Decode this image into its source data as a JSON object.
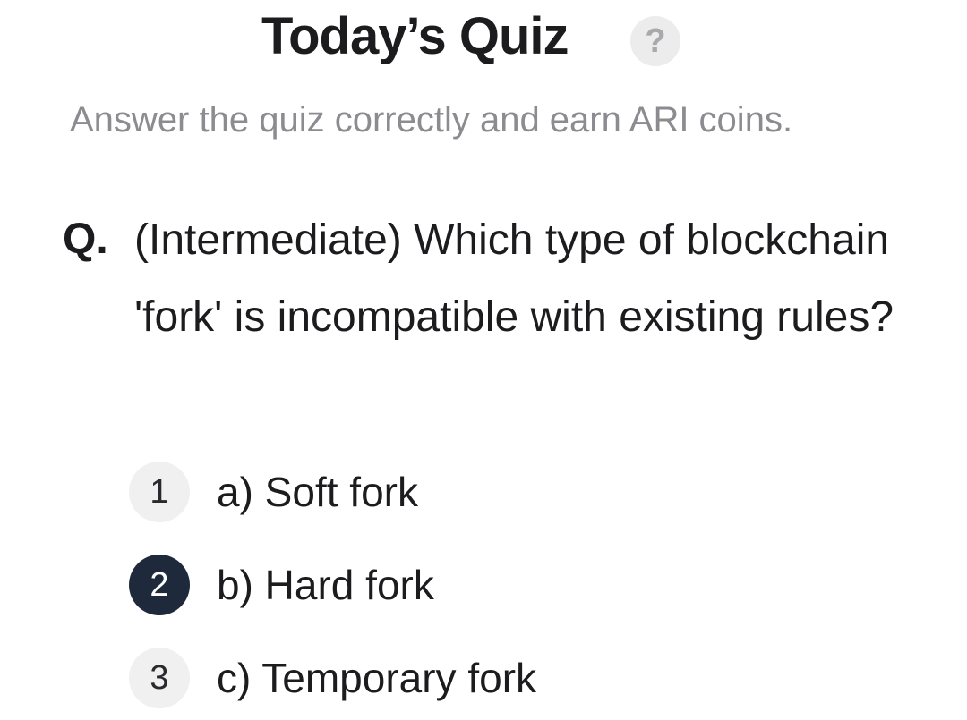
{
  "header": {
    "title": "Today’s Quiz",
    "help_icon": "question-mark-icon",
    "help_glyph": "?"
  },
  "subtitle": "Answer the quiz correctly and earn ARI coins.",
  "question": {
    "prefix": "Q.",
    "text": "(Intermediate) Which type of blockchain 'fork' is incompatible with existing rules?"
  },
  "options": [
    {
      "number": "1",
      "label": "a) Soft fork",
      "selected": false
    },
    {
      "number": "2",
      "label": "b) Hard fork",
      "selected": true
    },
    {
      "number": "3",
      "label": "c) Temporary fork",
      "selected": false
    }
  ],
  "colors": {
    "selected_badge": "#1e2a3c",
    "unselected_badge": "#f0f0f1",
    "subtitle_text": "#8c8c90"
  }
}
